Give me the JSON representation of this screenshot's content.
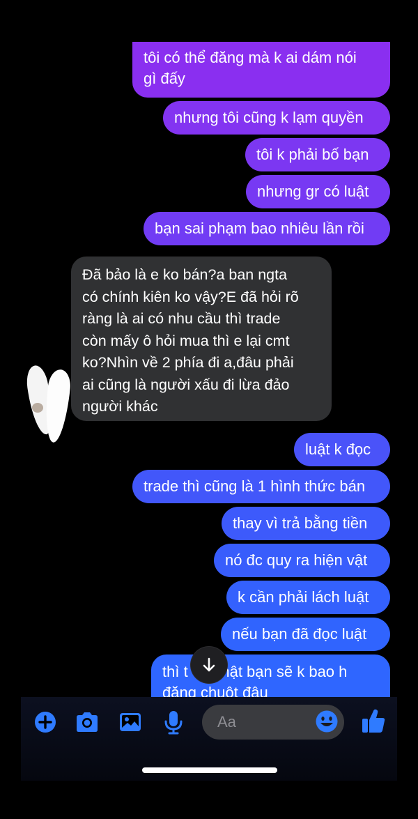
{
  "messages": {
    "m1": "tôi có thể đăng mà k ai dám nói\ngì đấy",
    "m2": "nhưng tôi cũng k lạm quyền",
    "m3": "tôi k phải bố bạn",
    "m4": "nhưng gr có luật",
    "m5": "bạn sai phạm bao nhiêu lần rồi",
    "m6": "Đã bảo là e ko bán?a ban ngta\ncó chính kiên ko vậy?E đã hỏi rõ\nràng là ai có nhu cầu thì trade\ncòn mấy ô hỏi mua thì e lại cmt\nko?Nhìn về 2 phía đi a,đâu phải\nai cũng là người xấu đi lừa đảo\nngười khác",
    "m7": "luật k đọc",
    "m8": "trade thì cũng là 1 hình thức bán",
    "m9": "thay vì trả bằng tiền",
    "m10": "nó đc quy ra hiện vật",
    "m11": "k cần phải lách luật",
    "m12": "nếu bạn đã đọc luật",
    "m13": "thì t     i thật bạn sẽ k bao h\nđăng chuột đâu"
  },
  "composer": {
    "placeholder": "Aa"
  },
  "colors": {
    "outgoing_top": "#8a2ff0",
    "outgoing_mid": "#6a3cf5",
    "outgoing_bottom": "#2f66ff",
    "incoming": "#303133",
    "accent": "#2f7bff"
  },
  "icons": {
    "add": "plus-circle-icon",
    "camera": "camera-icon",
    "gallery": "photo-gallery-icon",
    "mic": "microphone-icon",
    "emoji": "smiley-icon",
    "like": "thumbs-up-icon",
    "scroll": "arrow-down-icon"
  }
}
